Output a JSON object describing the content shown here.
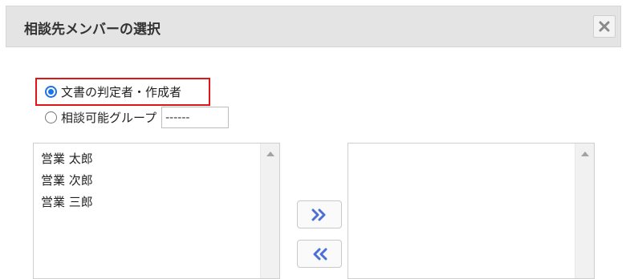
{
  "dialog": {
    "title": "相談先メンバーの選択",
    "close_icon": "close-icon"
  },
  "options": {
    "document_roles": {
      "label": "文書の判定者・作成者",
      "checked": true
    },
    "consult_group": {
      "label": "相談可能グループ",
      "checked": false,
      "input_value": "------"
    }
  },
  "lists": {
    "available": [
      "営業 太郎",
      "営業 次郎",
      "営業 三郎"
    ],
    "selected": []
  },
  "buttons": {
    "add_icon": "double-chevron-right-icon",
    "remove_icon": "double-chevron-left-icon"
  },
  "colors": {
    "accent": "#1a73e8",
    "highlight": "#e01515",
    "header_bg": "#e4e4e4",
    "arrow": "#4a6fd6"
  }
}
